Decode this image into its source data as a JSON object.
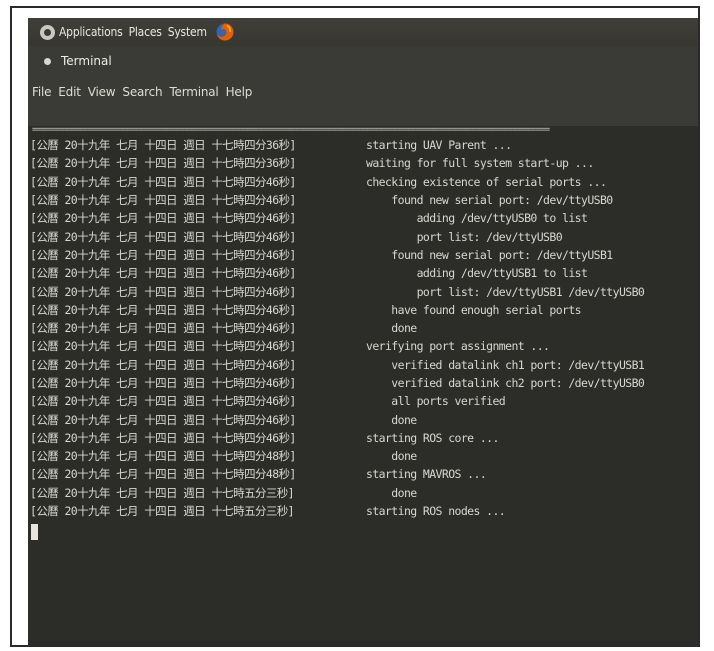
{
  "panel": {
    "menus": [
      "Applications",
      "Places",
      "System"
    ]
  },
  "window": {
    "title": "Terminal"
  },
  "menubar": {
    "items": [
      "File",
      "Edit",
      "View",
      "Search",
      "Terminal",
      "Help"
    ]
  },
  "terminal": {
    "rule": "================================================================================================================",
    "lines": [
      {
        "ts": "[公曆 20十九年 七月 十四日 週日 十七時四分36秒]",
        "msg": "starting UAV Parent ..."
      },
      {
        "ts": "[公曆 20十九年 七月 十四日 週日 十七時四分36秒]",
        "msg": "waiting for full system start-up ..."
      },
      {
        "ts": "[公曆 20十九年 七月 十四日 週日 十七時四分46秒]",
        "msg": "checking existence of serial ports ..."
      },
      {
        "ts": "[公曆 20十九年 七月 十四日 週日 十七時四分46秒]",
        "msg": "    found new serial port: /dev/ttyUSB0"
      },
      {
        "ts": "[公曆 20十九年 七月 十四日 週日 十七時四分46秒]",
        "msg": "        adding /dev/ttyUSB0 to list"
      },
      {
        "ts": "[公曆 20十九年 七月 十四日 週日 十七時四分46秒]",
        "msg": "        port list: /dev/ttyUSB0"
      },
      {
        "ts": "[公曆 20十九年 七月 十四日 週日 十七時四分46秒]",
        "msg": "    found new serial port: /dev/ttyUSB1"
      },
      {
        "ts": "[公曆 20十九年 七月 十四日 週日 十七時四分46秒]",
        "msg": "        adding /dev/ttyUSB1 to list"
      },
      {
        "ts": "[公曆 20十九年 七月 十四日 週日 十七時四分46秒]",
        "msg": "        port list: /dev/ttyUSB1 /dev/ttyUSB0"
      },
      {
        "ts": "[公曆 20十九年 七月 十四日 週日 十七時四分46秒]",
        "msg": "    have found enough serial ports"
      },
      {
        "ts": "[公曆 20十九年 七月 十四日 週日 十七時四分46秒]",
        "msg": "    done"
      },
      {
        "ts": "[公曆 20十九年 七月 十四日 週日 十七時四分46秒]",
        "msg": "verifying port assignment ..."
      },
      {
        "ts": "[公曆 20十九年 七月 十四日 週日 十七時四分46秒]",
        "msg": "    verified datalink ch1 port: /dev/ttyUSB1"
      },
      {
        "ts": "[公曆 20十九年 七月 十四日 週日 十七時四分46秒]",
        "msg": "    verified datalink ch2 port: /dev/ttyUSB0"
      },
      {
        "ts": "[公曆 20十九年 七月 十四日 週日 十七時四分46秒]",
        "msg": "    all ports verified"
      },
      {
        "ts": "[公曆 20十九年 七月 十四日 週日 十七時四分46秒]",
        "msg": "    done"
      },
      {
        "ts": "[公曆 20十九年 七月 十四日 週日 十七時四分46秒]",
        "msg": "starting ROS core ..."
      },
      {
        "ts": "[公曆 20十九年 七月 十四日 週日 十七時四分48秒]",
        "msg": "    done"
      },
      {
        "ts": "[公曆 20十九年 七月 十四日 週日 十七時四分48秒]",
        "msg": "starting MAVROS ..."
      },
      {
        "ts": "[公曆 20十九年 七月 十四日 週日 十七時五分三秒]",
        "msg": "    done"
      },
      {
        "ts": "[公曆 20十九年 七月 十四日 週日 十七時五分三秒]",
        "msg": "starting ROS nodes ..."
      }
    ]
  },
  "icons": {
    "distro": "ubuntu-logo-icon",
    "browser": "firefox-icon",
    "close": "close-dot-icon"
  },
  "colors": {
    "panel_bg": "#3c3b37",
    "terminal_bg": "#2c2c29",
    "terminal_fg": "#d8d6cf",
    "firefox_orange": "#e66000"
  }
}
